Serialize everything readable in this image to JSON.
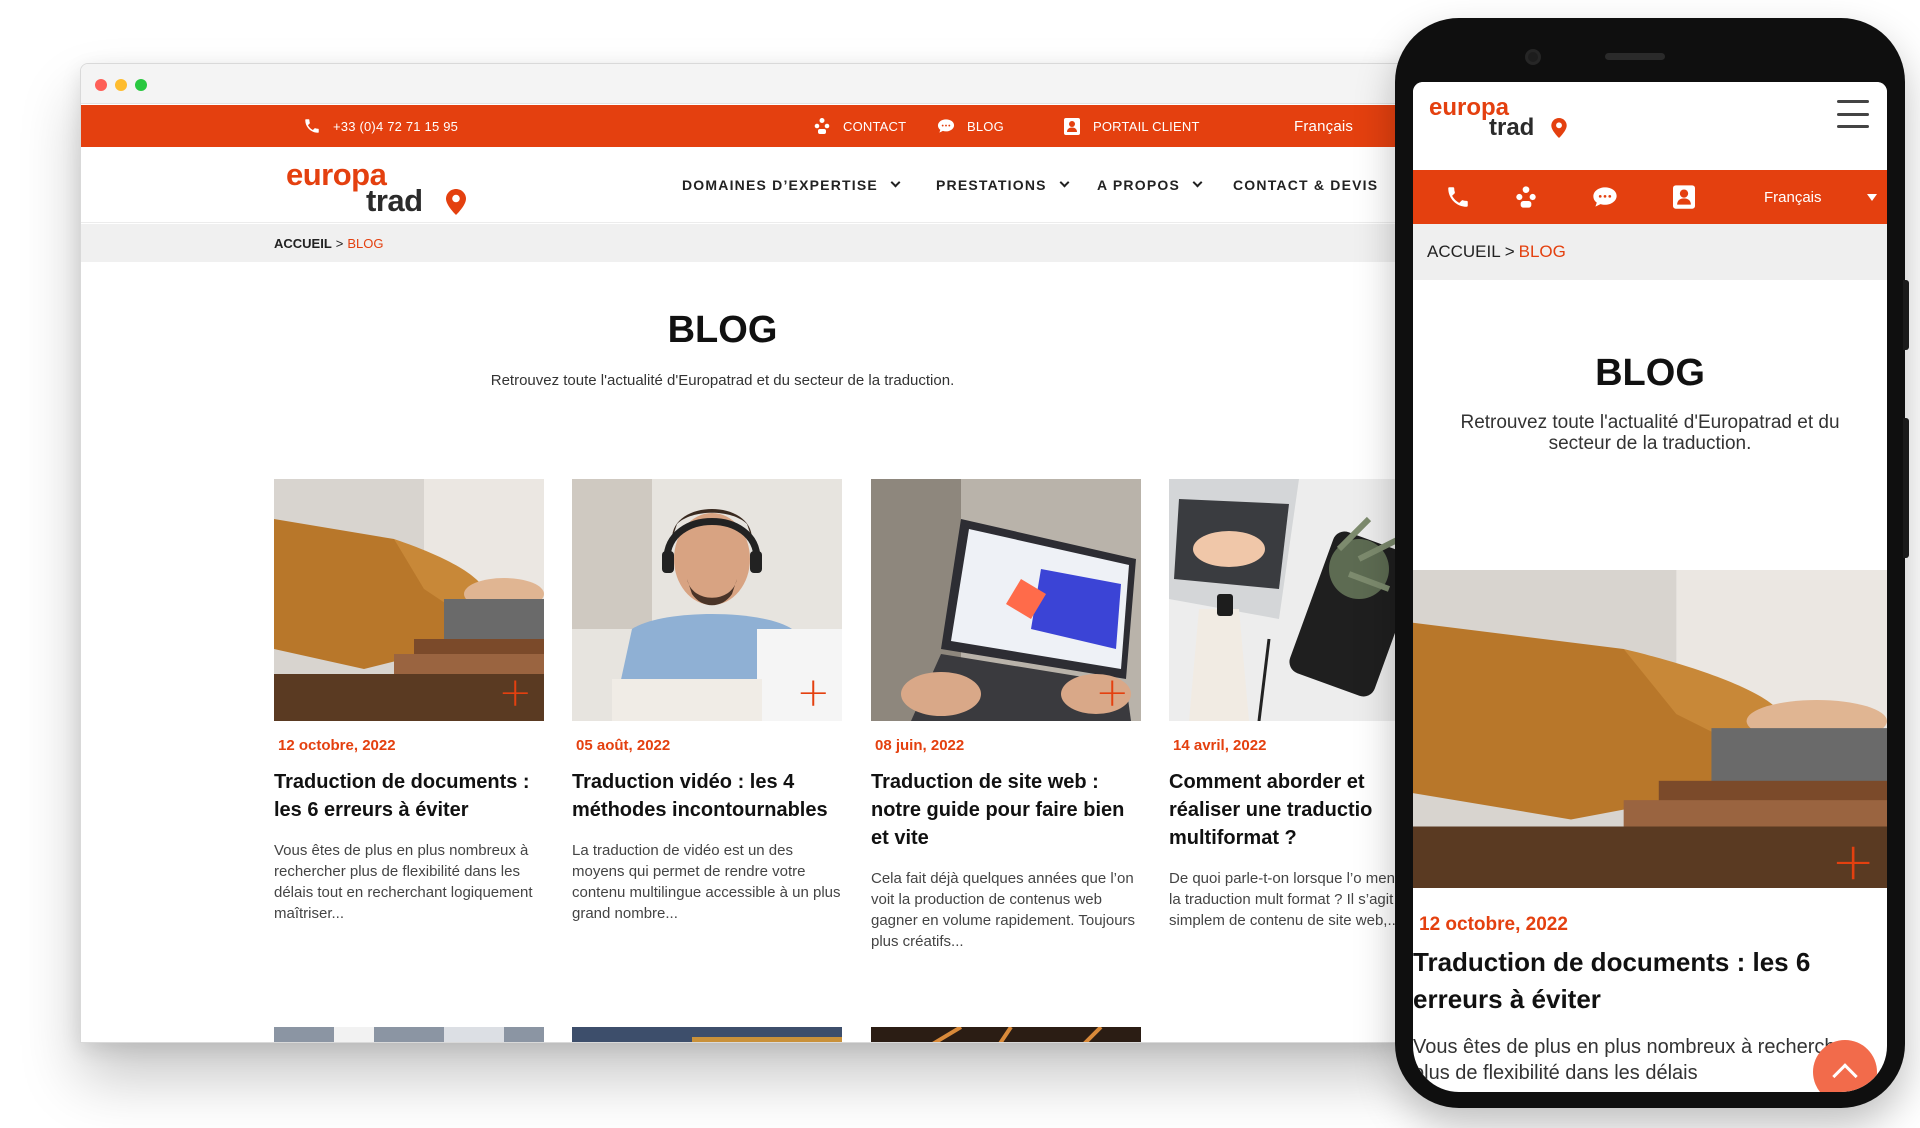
{
  "topbar": {
    "phone": "+33 (0)4 72 71 15 95",
    "contact": "CONTACT",
    "blog": "BLOG",
    "portal": "PORTAIL CLIENT",
    "language": "Français"
  },
  "brand": {
    "line1": "europa",
    "line2": "trad"
  },
  "nav": {
    "items": [
      {
        "label": "DOMAINES D’EXPERTISE"
      },
      {
        "label": "PRESTATIONS"
      },
      {
        "label": "A PROPOS"
      },
      {
        "label": "CONTACT & DEVIS"
      }
    ]
  },
  "breadcrumb": {
    "home": "ACCUEIL",
    "separator": ">",
    "current": "BLOG"
  },
  "hero": {
    "title": "BLOG",
    "subtitle": "Retrouvez toute l'actualité d'Europatrad et du secteur de la traduction."
  },
  "posts": [
    {
      "date": "12 octobre, 2022",
      "title": "Traduction de documents : les 6 erreurs à éviter",
      "excerpt": "Vous êtes de plus en plus nombreux à rechercher plus de flexibilité dans les délais tout en recherchant logiquement maîtriser..."
    },
    {
      "date": "05 août, 2022",
      "title": "Traduction vidéo : les 4 méthodes incontournables",
      "excerpt": "La traduction de vidéo est un des moyens qui permet de rendre votre contenu multilingue accessible à un plus grand nombre..."
    },
    {
      "date": "08 juin, 2022",
      "title": "Traduction de site web : notre guide pour faire bien et vite",
      "excerpt": "Cela fait déjà quelques années que l’on voit la production de contenus web gagner en volume rapidement. Toujours plus créatifs..."
    },
    {
      "date": "14 avril, 2022",
      "title": "Comment aborder et réaliser une traductio multiformat ?",
      "excerpt": "De quoi parle-t-on lorsque l’o mentionne la traduction mult format ? Il s’agit tout simplem de contenu de site web,..."
    }
  ],
  "mobile": {
    "language": "Français",
    "breadcrumb": {
      "home": "ACCUEIL",
      "separator": ">",
      "current": "BLOG"
    },
    "hero_title": "BLOG",
    "hero_subtitle": "Retrouvez toute l'actualité d'Europatrad et du secteur de la traduction.",
    "post": {
      "date": "12 octobre, 2022",
      "title": "Traduction de documents : les 6 erreurs à éviter",
      "excerpt": "Vous êtes de plus en plus nombreux à rechercher plus de flexibilité dans les délais"
    }
  },
  "colors": {
    "accent": "#e4400f",
    "text": "#111111",
    "crumb_bg": "#f0f0f0"
  },
  "icons": [
    "phone-icon",
    "contact-icon",
    "chat-icon",
    "portal-icon",
    "chevron-down-icon",
    "plus-icon",
    "menu-icon",
    "scroll-top-icon"
  ]
}
